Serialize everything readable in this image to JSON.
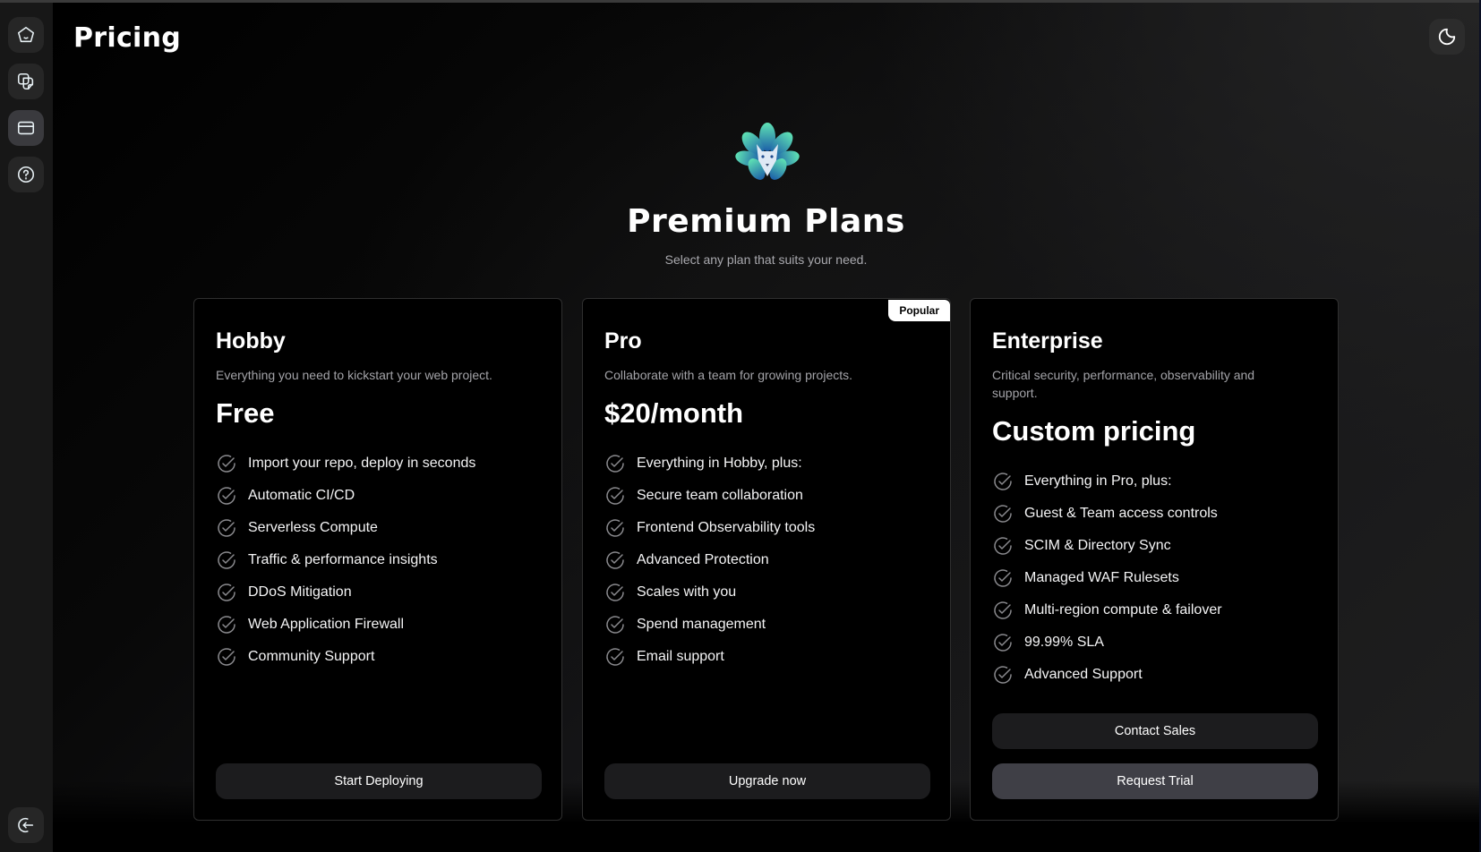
{
  "sidebar": {
    "items": [
      {
        "name": "home",
        "icon": "home-icon",
        "active": false
      },
      {
        "name": "documents",
        "icon": "documents-icon",
        "active": false
      },
      {
        "name": "pricing",
        "icon": "credit-card-icon",
        "active": true
      },
      {
        "name": "help",
        "icon": "help-circle-icon",
        "active": false
      }
    ],
    "logout_icon": "logout-icon"
  },
  "header": {
    "title": "Pricing",
    "theme_toggle_icon": "moon-icon"
  },
  "hero": {
    "logo": "fox-logo",
    "title": "Premium Plans",
    "subtitle": "Select any plan that suits your need."
  },
  "plans": [
    {
      "name": "Hobby",
      "description": "Everything you need to kickstart your web project.",
      "price": "Free",
      "features": [
        "Import your repo, deploy in seconds",
        "Automatic CI/CD",
        "Serverless Compute",
        "Traffic & performance insights",
        "DDoS Mitigation",
        "Web Application Firewall",
        "Community Support"
      ],
      "buttons": [
        {
          "label": "Start Deploying",
          "style": "primary"
        }
      ]
    },
    {
      "name": "Pro",
      "badge": "Popular",
      "description": "Collaborate with a team for growing projects.",
      "price": "$20/month",
      "features": [
        "Everything in Hobby, plus:",
        "Secure team collaboration",
        "Frontend Observability tools",
        "Advanced Protection",
        "Scales with you",
        "Spend management",
        "Email support"
      ],
      "buttons": [
        {
          "label": "Upgrade now",
          "style": "primary"
        }
      ]
    },
    {
      "name": "Enterprise",
      "description": "Critical security, performance, observability and support.",
      "price": "Custom pricing",
      "features": [
        "Everything in Pro, plus:",
        "Guest & Team access controls",
        "SCIM & Directory Sync",
        "Managed WAF Rulesets",
        "Multi-region compute & failover",
        "99.99% SLA",
        "Advanced Support"
      ],
      "buttons": [
        {
          "label": "Contact Sales",
          "style": "primary"
        },
        {
          "label": "Request Trial",
          "style": "secondary"
        }
      ]
    }
  ],
  "colors": {
    "background": "#000000",
    "sidebar": "#171717",
    "button": "#1c1c1e",
    "button_secondary": "#3f3f46",
    "muted_text": "#a3a3a8"
  }
}
